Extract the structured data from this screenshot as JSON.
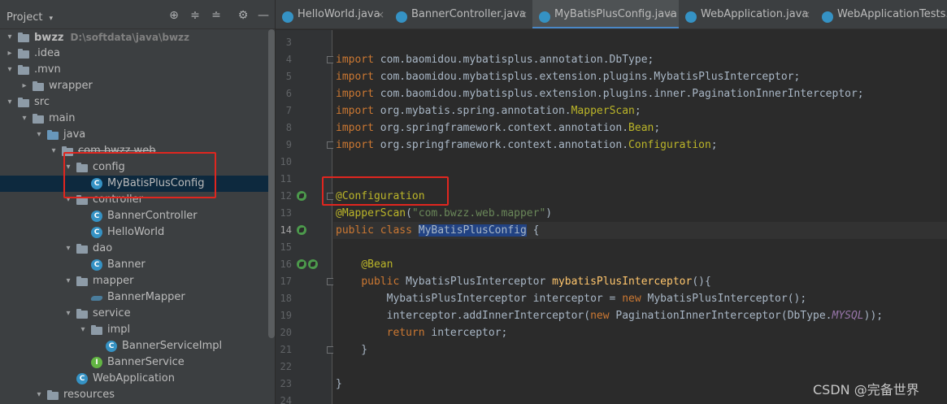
{
  "panel": {
    "title": "Project",
    "dropdown_glyph": "▾",
    "icons": [
      "crosshair-icon",
      "expand-all-icon",
      "collapse-all-icon",
      "gear-icon",
      "minimize-icon"
    ],
    "icon_glyphs": [
      "⊕",
      "≑",
      "≐",
      "⚙",
      "—"
    ]
  },
  "tree": [
    {
      "depth": 0,
      "arrow": "▾",
      "icon": "folder",
      "label": "bwzz",
      "hint": "D:\\softdata\\java\\bwzz",
      "bold": true
    },
    {
      "depth": 0,
      "arrow": "▸",
      "icon": "folder",
      "label": ".idea"
    },
    {
      "depth": 0,
      "arrow": "▾",
      "icon": "folder",
      "label": ".mvn"
    },
    {
      "depth": 1,
      "arrow": "▸",
      "icon": "folder",
      "label": "wrapper"
    },
    {
      "depth": 0,
      "arrow": "▾",
      "icon": "folder",
      "label": "src"
    },
    {
      "depth": 1,
      "arrow": "▾",
      "icon": "folder",
      "label": "main"
    },
    {
      "depth": 2,
      "arrow": "▾",
      "icon": "folder-src",
      "label": "java"
    },
    {
      "depth": 3,
      "arrow": "▾",
      "icon": "folder",
      "label": "com.bwzz.web",
      "strike": true
    },
    {
      "depth": 4,
      "arrow": "▾",
      "icon": "folder",
      "label": "config"
    },
    {
      "depth": 5,
      "arrow": "",
      "icon": "class",
      "label": "MyBatisPlusConfig",
      "selected": true
    },
    {
      "depth": 4,
      "arrow": "▾",
      "icon": "folder",
      "label": "controller"
    },
    {
      "depth": 5,
      "arrow": "",
      "icon": "class",
      "label": "BannerController"
    },
    {
      "depth": 5,
      "arrow": "",
      "icon": "class",
      "label": "HelloWorld"
    },
    {
      "depth": 4,
      "arrow": "▾",
      "icon": "folder",
      "label": "dao"
    },
    {
      "depth": 5,
      "arrow": "",
      "icon": "class",
      "label": "Banner"
    },
    {
      "depth": 4,
      "arrow": "▾",
      "icon": "folder",
      "label": "mapper"
    },
    {
      "depth": 5,
      "arrow": "",
      "icon": "mapper",
      "label": "BannerMapper"
    },
    {
      "depth": 4,
      "arrow": "▾",
      "icon": "folder",
      "label": "service"
    },
    {
      "depth": 5,
      "arrow": "▾",
      "icon": "folder",
      "label": "impl"
    },
    {
      "depth": 6,
      "arrow": "",
      "icon": "class",
      "label": "BannerServiceImpl"
    },
    {
      "depth": 5,
      "arrow": "",
      "icon": "interface",
      "label": "BannerService"
    },
    {
      "depth": 4,
      "arrow": "",
      "icon": "class",
      "label": "WebApplication"
    },
    {
      "depth": 2,
      "arrow": "▾",
      "icon": "folder",
      "label": "resources"
    }
  ],
  "tabs": [
    {
      "label": "HelloWorld.java",
      "close": "×"
    },
    {
      "label": "BannerController.java",
      "close": "×"
    },
    {
      "label": "MyBatisPlusConfig.java",
      "close": "×",
      "active": true
    },
    {
      "label": "WebApplication.java",
      "close": "×"
    },
    {
      "label": "WebApplicationTests.java",
      "close": ""
    }
  ],
  "editor": {
    "current_line": 14,
    "lines": [
      {
        "n": 3,
        "tokens": []
      },
      {
        "n": 4,
        "tokens": [
          [
            "kw",
            "import "
          ],
          [
            "t",
            "com.baomidou.mybatisplus.annotation.DbType;"
          ]
        ],
        "fold": true
      },
      {
        "n": 5,
        "tokens": [
          [
            "kw",
            "import "
          ],
          [
            "t",
            "com.baomidou.mybatisplus.extension.plugins.MybatisPlusInterceptor;"
          ]
        ]
      },
      {
        "n": 6,
        "tokens": [
          [
            "kw",
            "import "
          ],
          [
            "t",
            "com.baomidou.mybatisplus.extension.plugins.inner.PaginationInnerInterceptor;"
          ]
        ]
      },
      {
        "n": 7,
        "tokens": [
          [
            "kw",
            "import "
          ],
          [
            "t",
            "org.mybatis.spring.annotation."
          ],
          [
            "ann",
            "MapperScan"
          ],
          [
            "t",
            ";"
          ]
        ]
      },
      {
        "n": 8,
        "tokens": [
          [
            "kw",
            "import "
          ],
          [
            "t",
            "org.springframework.context.annotation."
          ],
          [
            "ann",
            "Bean"
          ],
          [
            "t",
            ";"
          ]
        ]
      },
      {
        "n": 9,
        "tokens": [
          [
            "kw",
            "import "
          ],
          [
            "t",
            "org.springframework.context.annotation."
          ],
          [
            "ann",
            "Configuration"
          ],
          [
            "t",
            ";"
          ]
        ],
        "fold": true
      },
      {
        "n": 10,
        "tokens": []
      },
      {
        "n": 11,
        "tokens": []
      },
      {
        "n": 12,
        "tokens": [
          [
            "ann",
            "@Configuration"
          ]
        ],
        "fold": true,
        "mark": true
      },
      {
        "n": 13,
        "tokens": [
          [
            "ann",
            "@MapperScan"
          ],
          [
            "t",
            "("
          ],
          [
            "str",
            "\"com.bwzz.web.mapper\""
          ],
          [
            "t",
            ")"
          ]
        ]
      },
      {
        "n": 14,
        "tokens": [
          [
            "kw",
            "public class "
          ],
          [
            "hl",
            "MyBatisPlusConfig"
          ],
          [
            "t",
            " {"
          ]
        ],
        "mark": true
      },
      {
        "n": 15,
        "tokens": []
      },
      {
        "n": 16,
        "tokens": [
          [
            "t",
            "    "
          ],
          [
            "ann",
            "@Bean"
          ]
        ],
        "mark": true,
        "mark2": true
      },
      {
        "n": 17,
        "tokens": [
          [
            "t",
            "    "
          ],
          [
            "kw",
            "public "
          ],
          [
            "t",
            "MybatisPlusInterceptor "
          ],
          [
            "fn",
            "mybatisPlusInterceptor"
          ],
          [
            "t",
            "(){"
          ]
        ],
        "fold": true
      },
      {
        "n": 18,
        "tokens": [
          [
            "t",
            "        MybatisPlusInterceptor interceptor = "
          ],
          [
            "kw",
            "new "
          ],
          [
            "t",
            "MybatisPlusInterceptor();"
          ]
        ]
      },
      {
        "n": 19,
        "tokens": [
          [
            "t",
            "        interceptor.addInnerInterceptor("
          ],
          [
            "kw",
            "new "
          ],
          [
            "t",
            "PaginationInnerInterceptor(DbType."
          ],
          [
            "cst",
            "MYSQL"
          ],
          [
            "t",
            "));"
          ]
        ]
      },
      {
        "n": 20,
        "tokens": [
          [
            "t",
            "        "
          ],
          [
            "kw",
            "return "
          ],
          [
            "t",
            "interceptor;"
          ]
        ]
      },
      {
        "n": 21,
        "tokens": [
          [
            "t",
            "    }"
          ]
        ],
        "fold": true
      },
      {
        "n": 22,
        "tokens": []
      },
      {
        "n": 23,
        "tokens": [
          [
            "t",
            "}"
          ]
        ]
      },
      {
        "n": 24,
        "tokens": []
      }
    ]
  },
  "watermark": "CSDN @完备世界",
  "colors": {
    "highlight_box": "#e0261f",
    "accent": "#4a88c7"
  }
}
